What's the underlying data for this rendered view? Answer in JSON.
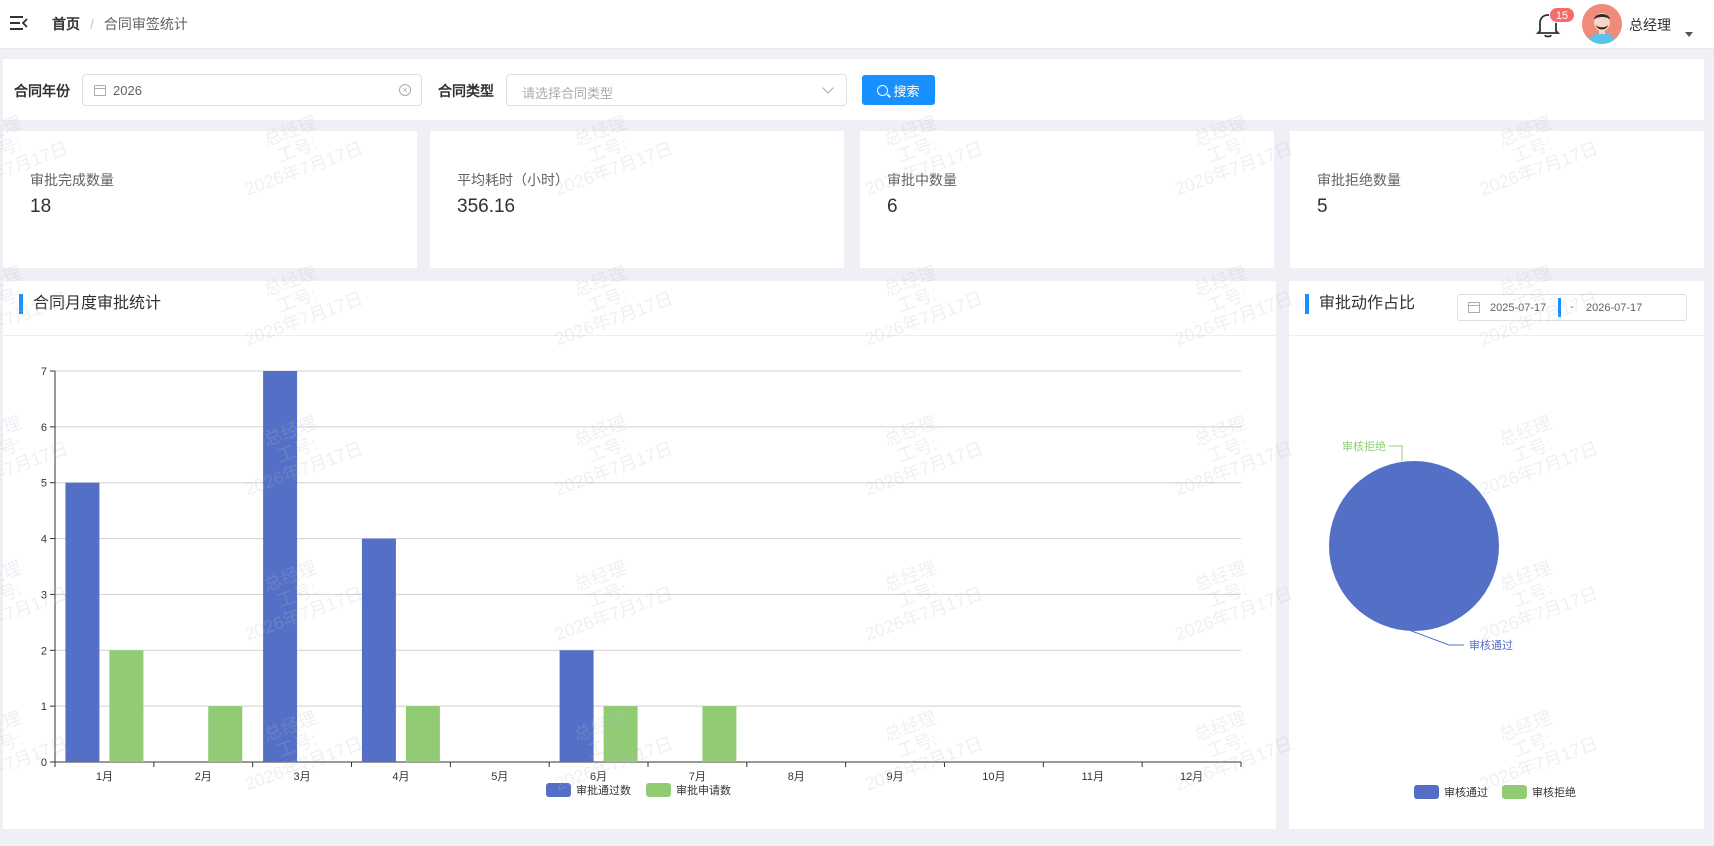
{
  "header": {
    "breadcrumb": {
      "home": "首页",
      "separator": "/",
      "current": "合同审签统计"
    },
    "notification_count": "15",
    "username": "总经理"
  },
  "filters": {
    "year_label": "合同年份",
    "year_value": "2026",
    "type_label": "合同类型",
    "type_placeholder": "请选择合同类型",
    "search_label": "搜索"
  },
  "stats": [
    {
      "label": "审批完成数量",
      "value": "18"
    },
    {
      "label": "平均耗时（小时）",
      "value": "356.16"
    },
    {
      "label": "审批中数量",
      "value": "6"
    },
    {
      "label": "审批拒绝数量",
      "value": "5"
    }
  ],
  "colors": {
    "accent": "#1890ff",
    "series_blue": "#5470c6",
    "series_green": "#91cc75",
    "badge": "#f56c6c"
  },
  "chart_data": [
    {
      "type": "bar",
      "title": "合同月度审批统计",
      "categories": [
        "1月",
        "2月",
        "3月",
        "4月",
        "5月",
        "6月",
        "7月",
        "8月",
        "9月",
        "10月",
        "11月",
        "12月"
      ],
      "series": [
        {
          "name": "审批通过数",
          "color": "#5470c6",
          "values": [
            5,
            0,
            7,
            4,
            0,
            2,
            0,
            0,
            0,
            0,
            0,
            0
          ]
        },
        {
          "name": "审批申请数",
          "color": "#91cc75",
          "values": [
            2,
            1,
            0,
            1,
            0,
            1,
            1,
            0,
            0,
            0,
            0,
            0
          ]
        }
      ],
      "ylim": [
        0,
        7
      ],
      "yticks": [
        0,
        1,
        2,
        3,
        4,
        5,
        6,
        7
      ],
      "grid": true,
      "legend": "bottom"
    },
    {
      "type": "pie",
      "title": "审批动作占比",
      "date_range": {
        "start": "2025-07-17",
        "separator": "-",
        "end": "2026-07-17"
      },
      "slices": [
        {
          "name": "审核通过",
          "value": 100,
          "color": "#5470c6"
        },
        {
          "name": "审核拒绝",
          "value": 0,
          "color": "#91cc75"
        }
      ],
      "legend": "bottom"
    }
  ],
  "watermark": {
    "name": "总经理",
    "id_label": "工号:",
    "date": "2026年7月17日"
  }
}
